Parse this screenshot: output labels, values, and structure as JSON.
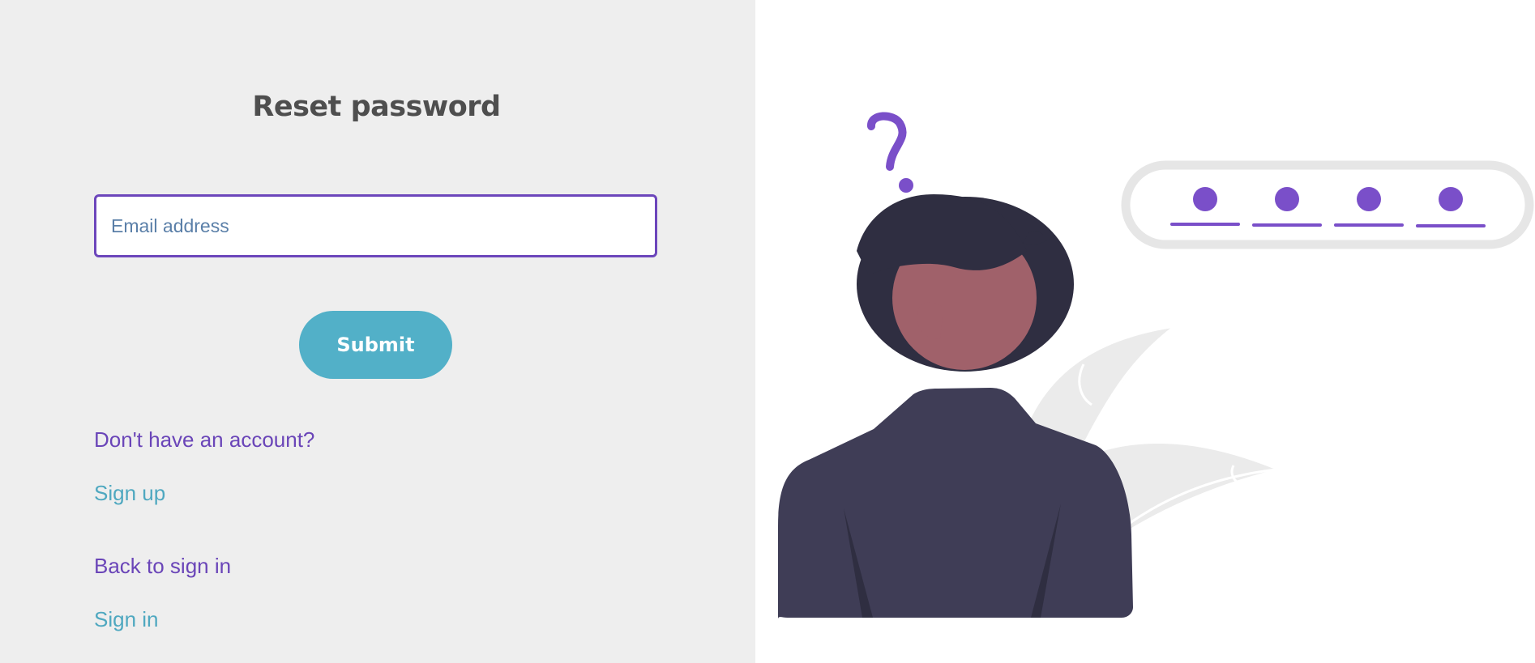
{
  "form": {
    "title": "Reset password",
    "email_placeholder": "Email address",
    "submit_label": "Submit"
  },
  "links": {
    "no_account_label": "Don't have an account?",
    "sign_up_label": "Sign up",
    "back_to_sign_in_label": "Back to sign in",
    "sign_in_label": "Sign in"
  },
  "illustration": {
    "question_mark": "?",
    "password_dot_count": 4,
    "icons": [
      "question-mark-icon",
      "password-field-icon",
      "person-icon",
      "plant-leaf-icon"
    ]
  },
  "colors": {
    "primary": "#6a45b8",
    "accent": "#52b0c8",
    "left_background": "#eeeeee",
    "person_body": "#3f3d56",
    "person_hair": "#2f2e41",
    "person_skin": "#a0616a"
  }
}
